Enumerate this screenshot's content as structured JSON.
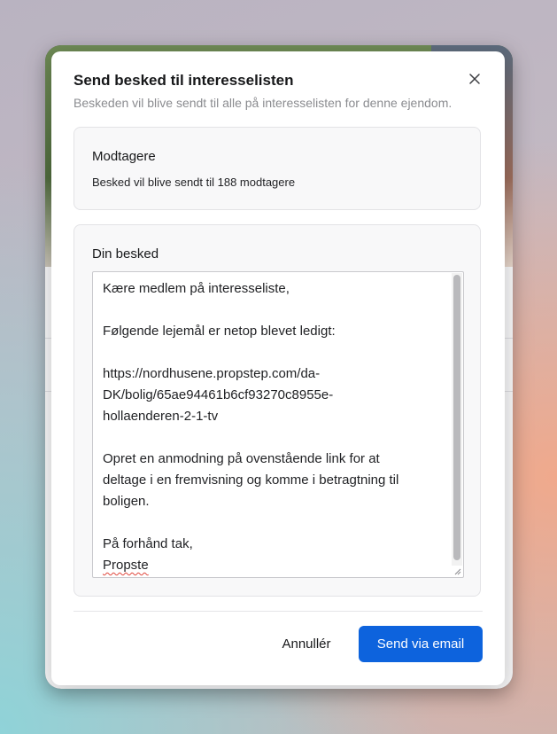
{
  "modal": {
    "title": "Send besked til interesselisten",
    "subtitle": "Beskeden vil blive sendt til alle på interesselisten for denne ejendom.",
    "close_icon": "close-icon"
  },
  "recipients": {
    "heading": "Modtagere",
    "text": "Besked vil blive sendt til 188 modtagere"
  },
  "message": {
    "heading": "Din besked",
    "lines": [
      "Kære medlem på interesseliste,",
      "",
      "Følgende lejemål er netop blevet ledigt:",
      "",
      "https://nordhusene.propstep.com/da-",
      "DK/bolig/65ae94461b6cf93270c8955e-",
      "hollaenderen-2-1-tv",
      "",
      "Opret en anmodning på ovenstående link for at",
      "deltage i en fremvisning og komme i betragtning til",
      "boligen.",
      "",
      "På forhånd tak,"
    ],
    "last_line": "Propste"
  },
  "footer": {
    "cancel_label": "Annullér",
    "send_label": "Send via email"
  },
  "colors": {
    "accent": "#0d63dd",
    "spellcheck": "#e0463c"
  }
}
